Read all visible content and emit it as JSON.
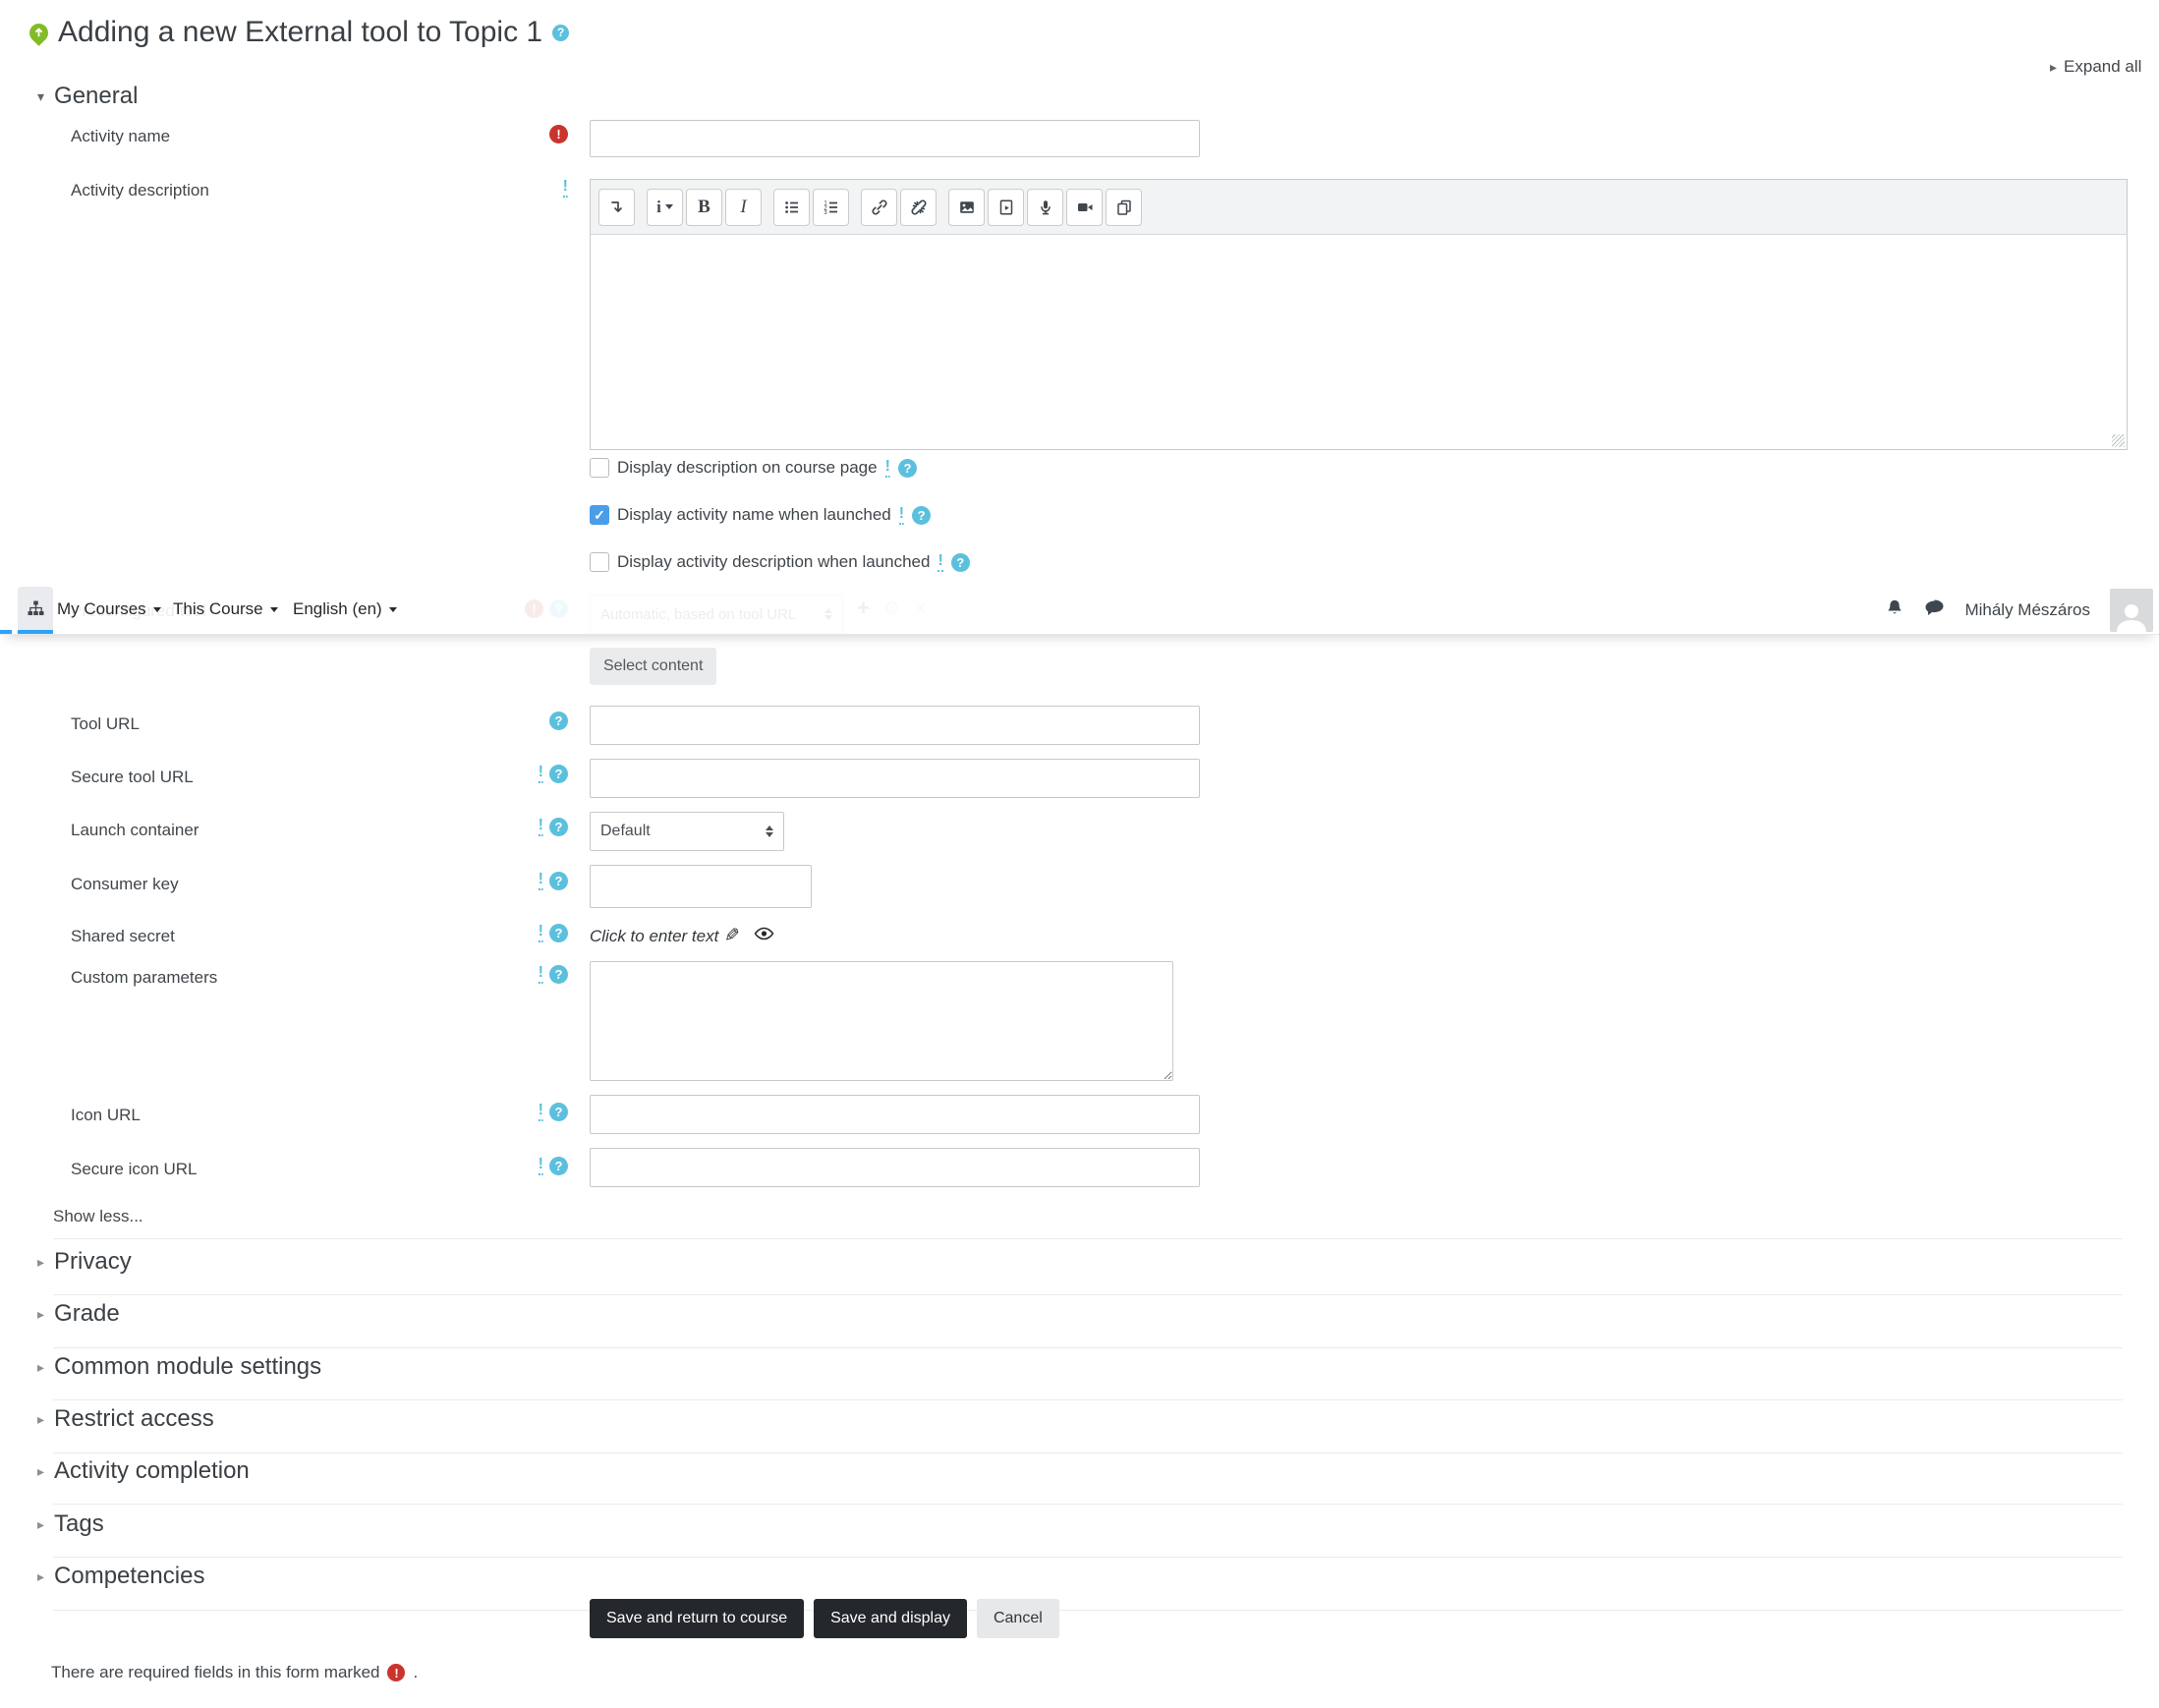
{
  "header": {
    "title": "Adding a new External tool to Topic 1",
    "expand_all": "Expand all"
  },
  "navbar": {
    "my_courses": "My Courses",
    "this_course": "This Course",
    "language": "English (en)",
    "user_name": "Mihály Mészáros"
  },
  "icons": {
    "help_glyph": "?",
    "required_glyph": "!",
    "advanced_glyph": "!",
    "plus_glyph": "+",
    "gear_glyph": "⚙",
    "close_glyph": "✕",
    "check_glyph": "✓",
    "pencil_glyph": "✎",
    "expand_tri": "▸",
    "collapse_tri": "▾"
  },
  "editor": {
    "style_glyph": "i",
    "bold_glyph": "B",
    "italic_glyph": "I",
    "toolbar_icon_names": [
      "collapse-toolbar",
      "paragraph-style",
      "bold",
      "italic",
      "unordered-list",
      "ordered-list",
      "link",
      "unlink",
      "insert-image",
      "insert-media",
      "record-audio",
      "record-video",
      "manage-files"
    ]
  },
  "general": {
    "section_title": "General",
    "activity_name_label": "Activity name",
    "activity_description_label": "Activity description",
    "display_description_label": "Display description on course page",
    "display_name_label": "Display activity name when launched",
    "display_activity_desc_label": "Display activity description when launched",
    "preconfigured_tool_label": "Preconfigured tool",
    "preconfigured_tool_value": "Automatic, based on tool URL",
    "select_content": "Select content",
    "tool_url_label": "Tool URL",
    "secure_tool_url_label": "Secure tool URL",
    "launch_container_label": "Launch container",
    "launch_container_value": "Default",
    "consumer_key_label": "Consumer key",
    "shared_secret_label": "Shared secret",
    "shared_secret_value": "Click to enter text",
    "custom_parameters_label": "Custom parameters",
    "icon_url_label": "Icon URL",
    "secure_icon_url_label": "Secure icon URL",
    "show_less": "Show less..."
  },
  "sections": {
    "privacy": "Privacy",
    "grade": "Grade",
    "common": "Common module settings",
    "restrict": "Restrict access",
    "completion": "Activity completion",
    "tags": "Tags",
    "competencies": "Competencies"
  },
  "buttons": {
    "save_return": "Save and return to course",
    "save_display": "Save and display",
    "cancel": "Cancel"
  },
  "footer": {
    "required_note": "There are required fields in this form marked",
    "suffix": "."
  },
  "state": {
    "display_name_checked": true
  },
  "colors": {
    "accent_blue": "#2ea2f8",
    "help_blue": "#5bc0de",
    "required_red": "#ca342c",
    "checkbox_blue": "#4a9de9",
    "button_dark": "#24272b",
    "tool_green": "#83bb26"
  }
}
